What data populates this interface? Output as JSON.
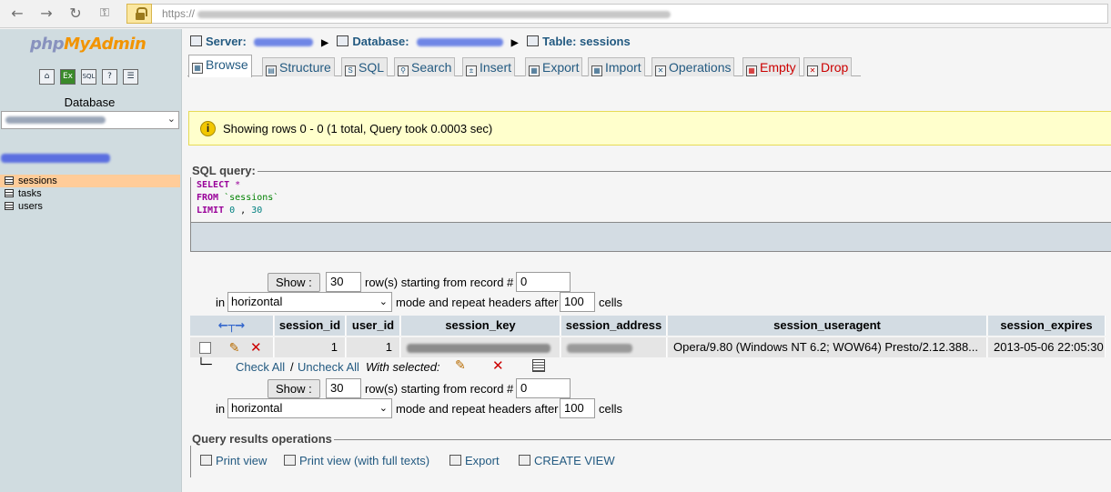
{
  "browser": {
    "url_prefix": "https://",
    "back_icon": "arrow-left-icon",
    "forward_icon": "arrow-right-icon",
    "reload_icon": "reload-icon",
    "key_icon": "key-icon",
    "lock_icon": "lock-icon"
  },
  "sidebar": {
    "logo_php": "php",
    "logo_my": "My",
    "logo_admin": "Admin",
    "icons": [
      "home-icon",
      "exit-icon",
      "sql-icon",
      "help-icon",
      "docs-icon"
    ],
    "icon_glyphs": [
      "⌂",
      "Ex",
      "SQL",
      "?",
      "☰"
    ],
    "database_label": "Database",
    "tables": [
      {
        "name": "sessions",
        "active": true
      },
      {
        "name": "tasks",
        "active": false
      },
      {
        "name": "users",
        "active": false
      }
    ]
  },
  "breadcrumb": {
    "server_label": "Server:",
    "database_label": "Database:",
    "table_label": "Table: sessions"
  },
  "tabs": [
    {
      "label": "Browse",
      "glyph": "▦",
      "active": true,
      "red": false
    },
    {
      "label": "Structure",
      "glyph": "▤",
      "active": false,
      "red": false
    },
    {
      "label": "SQL",
      "glyph": "S",
      "active": false,
      "red": false
    },
    {
      "label": "Search",
      "glyph": "⚲",
      "active": false,
      "red": false
    },
    {
      "label": "Insert",
      "glyph": "±",
      "active": false,
      "red": false
    },
    {
      "label": "Export",
      "glyph": "▦",
      "active": false,
      "red": false
    },
    {
      "label": "Import",
      "glyph": "▦",
      "active": false,
      "red": false
    },
    {
      "label": "Operations",
      "glyph": "✕",
      "active": false,
      "red": false
    },
    {
      "label": "Empty",
      "glyph": "▦",
      "active": false,
      "red": true
    },
    {
      "label": "Drop",
      "glyph": "✕",
      "active": false,
      "red": true
    }
  ],
  "notice": {
    "text": "Showing rows 0 - 0 (1 total, Query took 0.0003 sec)",
    "icon": "info-icon"
  },
  "sql_query": {
    "legend": "SQL query:",
    "select_kw": "SELECT",
    "select_rest": " *",
    "from_kw": "FROM",
    "from_table": " `sessions`",
    "limit_kw": "LIMIT",
    "limit_a": " 0",
    "limit_sep": " , ",
    "limit_b": "30"
  },
  "navigation": {
    "show_label": "Show :",
    "rows_value": "30",
    "rows_starting_label": "row(s) starting from record #",
    "start_value": "0",
    "in_label": "in",
    "mode_value": "horizontal",
    "mode_suffix_label": "mode and repeat headers after",
    "repeat_value": "100",
    "cells_label": "cells"
  },
  "results": {
    "headers": [
      "session_id",
      "user_id",
      "session_key",
      "session_address",
      "session_useragent",
      "session_expires"
    ],
    "rows": [
      {
        "session_id": "1",
        "user_id": "1",
        "session_useragent": "Opera/9.80 (Windows NT 6.2; WOW64) Presto/2.12.388...",
        "session_expires": "2013-05-06 22:05:30"
      }
    ]
  },
  "bulk": {
    "check_all": "Check All",
    "slash": "/",
    "uncheck_all": "Uncheck All",
    "with_selected": "With selected:"
  },
  "operations": {
    "legend": "Query results operations",
    "print_view": "Print view",
    "print_view_full": "Print view (with full texts)",
    "export": "Export",
    "create_view": "CREATE VIEW"
  }
}
